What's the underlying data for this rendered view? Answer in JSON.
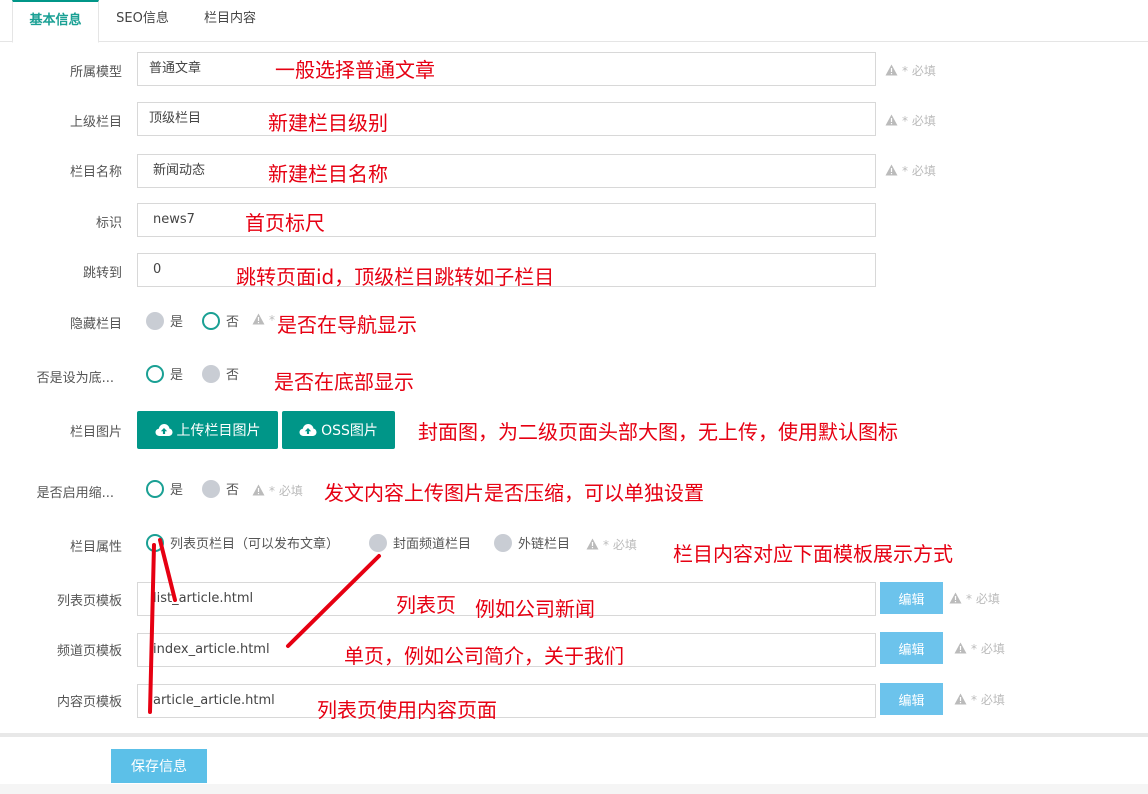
{
  "tabs": [
    "基本信息",
    "SEO信息",
    "栏目内容"
  ],
  "form": {
    "model": {
      "label": "所属模型",
      "value": "普通文章",
      "note": "一般选择普通文章"
    },
    "parent": {
      "label": "上级栏目",
      "value": "顶级栏目",
      "note": "新建栏目级别"
    },
    "name": {
      "label": "栏目名称",
      "value": "新闻动态",
      "note": "新建栏目名称"
    },
    "ident": {
      "label": "标识",
      "value": "news7",
      "note": "首页标尺"
    },
    "jump": {
      "label": "跳转到",
      "value": "0",
      "note": "跳转页面id，顶级栏目跳转如子栏目"
    },
    "hidden": {
      "label": "隐藏栏目",
      "opt_yes": "是",
      "opt_no": "否",
      "req_partial": "*",
      "note": "是否在导航显示"
    },
    "bottom": {
      "label": "否是设为底...",
      "opt_yes": "是",
      "opt_no": "否",
      "note": "是否在底部显示"
    },
    "image": {
      "label": "栏目图片",
      "upload_btn": "上传栏目图片",
      "oss_btn": "OSS图片",
      "note": "封面图，为二级页面头部大图，无上传，使用默认图标"
    },
    "compress": {
      "label": "是否启用缩...",
      "opt_yes": "是",
      "opt_no": "否",
      "note": "发文内容上传图片是否压缩，可以单独设置"
    },
    "attr": {
      "label": "栏目属性",
      "opt_list": "列表页栏目（可以发布文章）",
      "opt_cover": "封面频道栏目",
      "opt_link": "外链栏目",
      "note": "栏目内容对应下面模板展示方式"
    },
    "tpl_list": {
      "label": "列表页模板",
      "value": "list_article.html",
      "edit": "编辑",
      "note1": "列表页",
      "note2": "例如公司新闻"
    },
    "tpl_channel": {
      "label": "频道页模板",
      "value": "index_article.html",
      "edit": "编辑",
      "note": "单页，例如公司简介，关于我们"
    },
    "tpl_content": {
      "label": "内容页模板",
      "value": "article_article.html",
      "edit": "编辑",
      "note": "列表页使用内容页面"
    }
  },
  "required_text": "* 必填",
  "save_button": "保存信息",
  "colors": {
    "accent": "#009688",
    "note_red": "#e60012",
    "edit_blue": "#6cc3ec",
    "save_blue": "#5cc0e8"
  }
}
